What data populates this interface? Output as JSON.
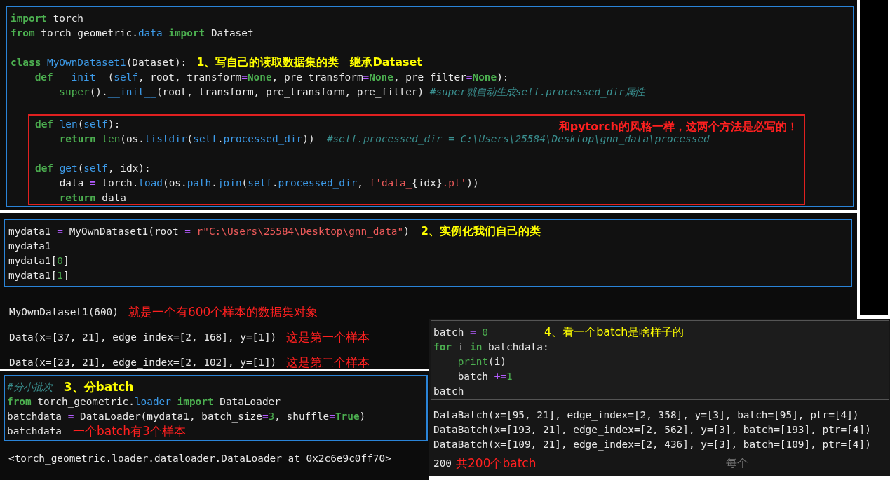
{
  "define_cell": {
    "lines": [
      {
        "kind": "code",
        "code": [
          {
            "text": "import",
            "kind": "kw"
          },
          {
            "text": " torch",
            "kind": "plain"
          }
        ]
      },
      {
        "kind": "code",
        "code": [
          {
            "text": "from",
            "kind": "kw"
          },
          {
            "text": " torch_geometric.",
            "kind": "plain"
          },
          {
            "text": "data ",
            "kind": "fn"
          },
          {
            "text": "import",
            "kind": "kw"
          },
          {
            "text": " Dataset",
            "kind": "plain"
          }
        ]
      },
      {
        "kind": "blank"
      },
      {
        "kind": "code",
        "code": [
          {
            "text": "class",
            "kind": "kw"
          },
          {
            "text": " MyOwnDataset1",
            "kind": "fn"
          },
          {
            "text": "(Dataset):",
            "kind": "plain"
          }
        ],
        "note": {
          "text": "1、写自己的读取数据集的类　继承Dataset",
          "color": "#ffff00",
          "bold": true
        }
      },
      {
        "kind": "code",
        "code": [
          {
            "text": "    def",
            "kind": "kw"
          },
          {
            "text": " __init__",
            "kind": "fn"
          },
          {
            "text": "(",
            "kind": "plain"
          },
          {
            "text": "self",
            "kind": "fn"
          },
          {
            "text": ", root, transform",
            "kind": "plain"
          },
          {
            "text": "=",
            "kind": "op"
          },
          {
            "text": "None",
            "kind": "kw"
          },
          {
            "text": ", pre_transform",
            "kind": "plain"
          },
          {
            "text": "=",
            "kind": "op"
          },
          {
            "text": "None",
            "kind": "kw"
          },
          {
            "text": ", pre_filter",
            "kind": "plain"
          },
          {
            "text": "=",
            "kind": "op"
          },
          {
            "text": "None",
            "kind": "kw"
          },
          {
            "text": "):",
            "kind": "plain"
          }
        ]
      },
      {
        "kind": "code",
        "code": [
          {
            "text": "        super",
            "kind": "bi"
          },
          {
            "text": "().",
            "kind": "plain"
          },
          {
            "text": "__init__",
            "kind": "fn"
          },
          {
            "text": "(root, transform, pre_transform, pre_filter) ",
            "kind": "plain"
          },
          {
            "text": "#super就自动生成self.processed_dir属性",
            "kind": "cmt"
          }
        ]
      },
      {
        "kind": "blank"
      }
    ],
    "boxed_lines": [
      {
        "kind": "code",
        "code": [
          {
            "text": "def",
            "kind": "kw"
          },
          {
            "text": " len",
            "kind": "fn"
          },
          {
            "text": "(",
            "kind": "plain"
          },
          {
            "text": "self",
            "kind": "fn"
          },
          {
            "text": "):",
            "kind": "plain"
          }
        ]
      },
      {
        "kind": "code",
        "code": [
          {
            "text": "    return",
            "kind": "kw"
          },
          {
            "text": " len",
            "kind": "bi"
          },
          {
            "text": "(os.",
            "kind": "plain"
          },
          {
            "text": "listdir",
            "kind": "fn"
          },
          {
            "text": "(",
            "kind": "plain"
          },
          {
            "text": "self",
            "kind": "fn"
          },
          {
            "text": ".",
            "kind": "plain"
          },
          {
            "text": "processed_dir",
            "kind": "fn"
          },
          {
            "text": "))  ",
            "kind": "plain"
          },
          {
            "text": "#self.processed_dir = C:\\Users\\25584\\Desktop\\gnn_data\\processed",
            "kind": "cmt"
          }
        ]
      },
      {
        "kind": "blank"
      },
      {
        "kind": "code",
        "code": [
          {
            "text": "def",
            "kind": "kw"
          },
          {
            "text": " get",
            "kind": "fn"
          },
          {
            "text": "(",
            "kind": "plain"
          },
          {
            "text": "self",
            "kind": "fn"
          },
          {
            "text": ", idx):",
            "kind": "plain"
          }
        ]
      },
      {
        "kind": "code",
        "code": [
          {
            "text": "    data ",
            "kind": "plain"
          },
          {
            "text": "=",
            "kind": "op"
          },
          {
            "text": " torch.",
            "kind": "plain"
          },
          {
            "text": "load",
            "kind": "fn"
          },
          {
            "text": "(os.",
            "kind": "plain"
          },
          {
            "text": "path",
            "kind": "fn"
          },
          {
            "text": ".",
            "kind": "plain"
          },
          {
            "text": "join",
            "kind": "fn"
          },
          {
            "text": "(",
            "kind": "plain"
          },
          {
            "text": "self",
            "kind": "fn"
          },
          {
            "text": ".",
            "kind": "plain"
          },
          {
            "text": "processed_dir",
            "kind": "fn"
          },
          {
            "text": ", ",
            "kind": "plain"
          },
          {
            "text": "f'data_",
            "kind": "str"
          },
          {
            "text": "{idx}",
            "kind": "plain"
          },
          {
            "text": ".pt'",
            "kind": "str"
          },
          {
            "text": "))",
            "kind": "plain"
          }
        ]
      },
      {
        "kind": "code",
        "code": [
          {
            "text": "    return",
            "kind": "kw"
          },
          {
            "text": " data",
            "kind": "plain"
          }
        ]
      }
    ],
    "box_note": {
      "text": "和pytorch的风格一样，这两个方法是必写的！",
      "color": "#ff2020",
      "bold": true
    }
  },
  "instance_cell": {
    "lines": [
      {
        "kind": "code",
        "code": [
          {
            "text": "mydata1 ",
            "kind": "plain"
          },
          {
            "text": "=",
            "kind": "op"
          },
          {
            "text": " MyOwnDataset1(root ",
            "kind": "plain"
          },
          {
            "text": "=",
            "kind": "op"
          },
          {
            "text": " r\"C:\\Users\\25584\\Desktop\\gnn_data\"",
            "kind": "str"
          },
          {
            "text": ")",
            "kind": "plain"
          }
        ],
        "note": {
          "text": "2、实例化我们自己的类",
          "color": "#ffff00",
          "bold": true
        }
      },
      {
        "kind": "code",
        "code": [
          {
            "text": "mydata1",
            "kind": "plain"
          }
        ]
      },
      {
        "kind": "code",
        "code": [
          {
            "text": "mydata1[",
            "kind": "plain"
          },
          {
            "text": "0",
            "kind": "num"
          },
          {
            "text": "]",
            "kind": "plain"
          }
        ]
      },
      {
        "kind": "code",
        "code": [
          {
            "text": "mydata1[",
            "kind": "plain"
          },
          {
            "text": "1",
            "kind": "num"
          },
          {
            "text": "]",
            "kind": "plain"
          }
        ]
      }
    ],
    "outputs": [
      {
        "text": "MyOwnDataset1(600)",
        "note": {
          "text": "就是一个有600个样本的数据集对象",
          "color": "#ff2020",
          "bold": false
        }
      },
      {
        "text": "Data(x=[37, 21], edge_index=[2, 168], y=[1])",
        "note": {
          "text": "这是第一个样本",
          "color": "#ff2020",
          "bold": false
        }
      },
      {
        "text": "Data(x=[23, 21], edge_index=[2, 102], y=[1])",
        "note": {
          "text": "这是第二个样本",
          "color": "#ff2020",
          "bold": false
        }
      }
    ]
  },
  "loader_cell": {
    "lines": [
      {
        "kind": "code",
        "code": [
          {
            "text": "#分小批次",
            "kind": "cmt"
          }
        ],
        "note": {
          "text": "3、分batch",
          "color": "#ffff00",
          "bold": true
        }
      },
      {
        "kind": "code",
        "code": [
          {
            "text": "from",
            "kind": "kw"
          },
          {
            "text": " torch_geometric.",
            "kind": "plain"
          },
          {
            "text": "loader ",
            "kind": "fn"
          },
          {
            "text": "import",
            "kind": "kw"
          },
          {
            "text": " DataLoader",
            "kind": "plain"
          }
        ]
      },
      {
        "kind": "code",
        "code": [
          {
            "text": "batchdata ",
            "kind": "plain"
          },
          {
            "text": "=",
            "kind": "op"
          },
          {
            "text": " DataLoader(mydata1, batch_size",
            "kind": "plain"
          },
          {
            "text": "=",
            "kind": "op"
          },
          {
            "text": "3",
            "kind": "num"
          },
          {
            "text": ", shuffle",
            "kind": "plain"
          },
          {
            "text": "=",
            "kind": "op"
          },
          {
            "text": "True",
            "kind": "kw"
          },
          {
            "text": ")",
            "kind": "plain"
          }
        ]
      },
      {
        "kind": "code",
        "code": [
          {
            "text": "batchdata",
            "kind": "plain"
          }
        ],
        "note": {
          "text": "一个batch有3个样本",
          "color": "#ff2020",
          "bold": false
        }
      }
    ],
    "outputs": [
      {
        "text": "<torch_geometric.loader.dataloader.DataLoader at 0x2c6e9c0ff70>"
      }
    ]
  },
  "batch_cell": {
    "lines": [
      {
        "kind": "code",
        "code": [
          {
            "text": "batch ",
            "kind": "plain"
          },
          {
            "text": "=",
            "kind": "op"
          },
          {
            "text": " 0",
            "kind": "num"
          }
        ],
        "note": {
          "text": "4、看一个batch是啥样子的",
          "color": "#ffff00",
          "bold": false
        }
      },
      {
        "kind": "code",
        "code": [
          {
            "text": "for",
            "kind": "kw"
          },
          {
            "text": " i ",
            "kind": "plain"
          },
          {
            "text": "in",
            "kind": "kw"
          },
          {
            "text": " batchdata:",
            "kind": "plain"
          }
        ]
      },
      {
        "kind": "code",
        "code": [
          {
            "text": "    print",
            "kind": "bi"
          },
          {
            "text": "(i)",
            "kind": "plain"
          }
        ]
      },
      {
        "kind": "code",
        "code": [
          {
            "text": "    batch ",
            "kind": "plain"
          },
          {
            "text": "+=",
            "kind": "op"
          },
          {
            "text": "1",
            "kind": "num"
          }
        ]
      },
      {
        "kind": "code",
        "code": [
          {
            "text": "batch",
            "kind": "plain"
          }
        ]
      }
    ],
    "outputs": [
      {
        "text": "DataBatch(x=[95, 21], edge_index=[2, 358], y=[3], batch=[95], ptr=[4])"
      },
      {
        "text": "DataBatch(x=[193, 21], edge_index=[2, 562], y=[3], batch=[193], ptr=[4])"
      },
      {
        "text": "DataBatch(x=[109, 21], edge_index=[2, 436], y=[3], batch=[109], ptr=[4])"
      },
      {
        "text": "200",
        "note": {
          "text": "共200个batch",
          "color": "#ff2020",
          "bold": false
        }
      }
    ],
    "hint": "每个"
  }
}
